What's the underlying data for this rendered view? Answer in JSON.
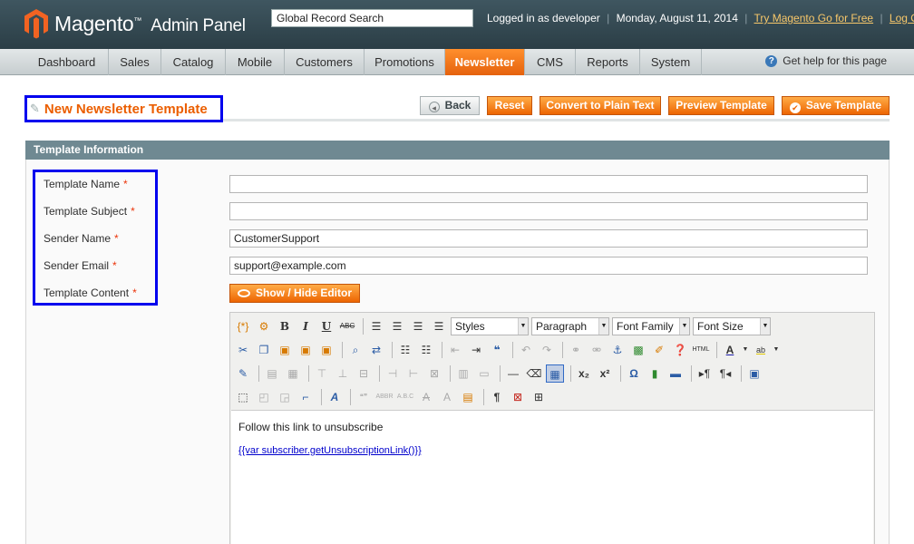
{
  "header": {
    "logo_brand": "Magento",
    "logo_tm": "™",
    "logo_sub": "Admin Panel",
    "search_value": "Global Record Search",
    "logged_in": "Logged in as developer",
    "date": "Monday, August 11, 2014",
    "try_link": "Try Magento Go for Free",
    "logout_link": "Log Out",
    "separator": "|"
  },
  "nav": {
    "items": [
      "Dashboard",
      "Sales",
      "Catalog",
      "Mobile",
      "Customers",
      "Promotions",
      "Newsletter",
      "CMS",
      "Reports",
      "System"
    ],
    "active": "Newsletter",
    "help": "Get help for this page"
  },
  "page": {
    "title": "New Newsletter Template",
    "buttons": {
      "back": "Back",
      "reset": "Reset",
      "convert": "Convert to Plain Text",
      "preview": "Preview Template",
      "save": "Save Template"
    }
  },
  "form": {
    "section_title": "Template Information",
    "required_mark": "*",
    "fields": {
      "name": {
        "label": "Template Name",
        "value": ""
      },
      "subject": {
        "label": "Template Subject",
        "value": ""
      },
      "sender_name": {
        "label": "Sender Name",
        "value": "CustomerSupport"
      },
      "sender_email": {
        "label": "Sender Email",
        "value": "support@example.com"
      },
      "content": {
        "label": "Template Content"
      }
    },
    "show_hide_editor": "Show / Hide Editor"
  },
  "editor": {
    "styles": "Styles",
    "format": "Paragraph",
    "font_family": "Font Family",
    "font_size": "Font Size",
    "content_line1": "Follow this link to unsubscribe",
    "content_link": "{{var subscriber.getUnsubscriptionLink()}}"
  },
  "colors": {
    "accent_orange": "#ed6502",
    "header_bg": "#2b3e46",
    "annotation_blue": "#0000ee"
  }
}
